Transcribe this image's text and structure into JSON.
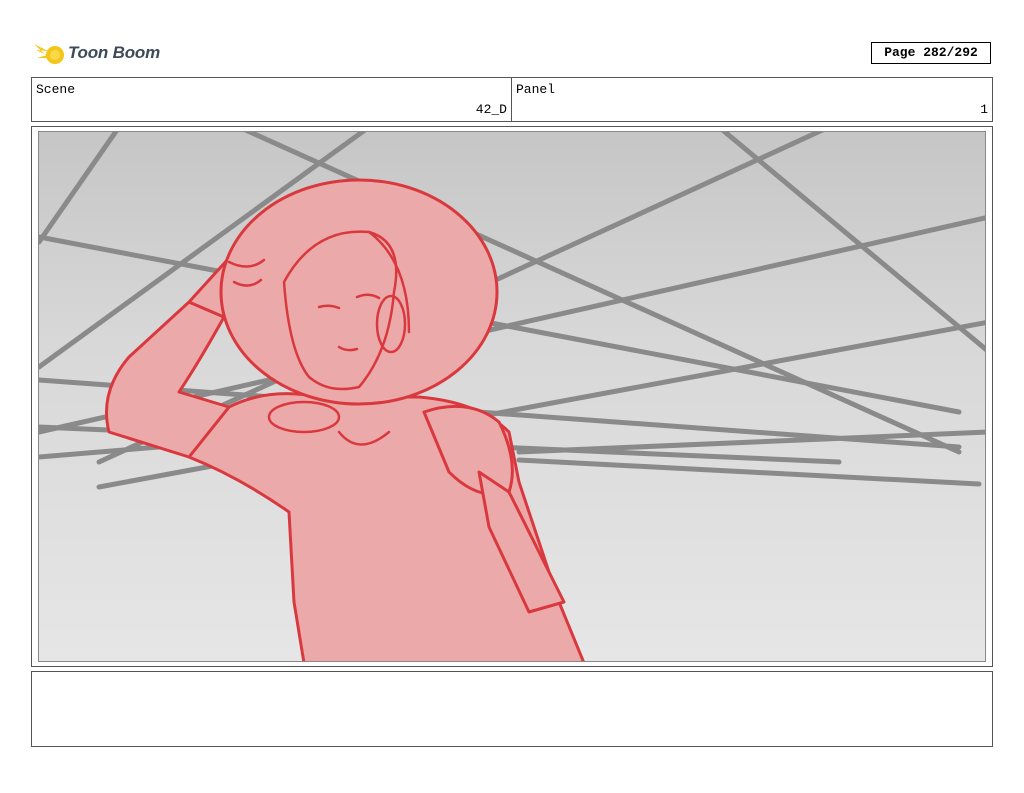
{
  "brand": {
    "name": "Toon Boom",
    "accent": "#f5c518"
  },
  "page": {
    "label": "Page 282/292"
  },
  "scene": {
    "label": "Scene",
    "value": "42_D"
  },
  "panel": {
    "label": "Panel",
    "value": "1"
  },
  "artwork": {
    "subject": "astronaut-salute-sketch",
    "line_color": "#d9393e",
    "fill_color": "#eba9a9",
    "grid_color": "#8a8a8a"
  },
  "notes": {
    "text": ""
  }
}
